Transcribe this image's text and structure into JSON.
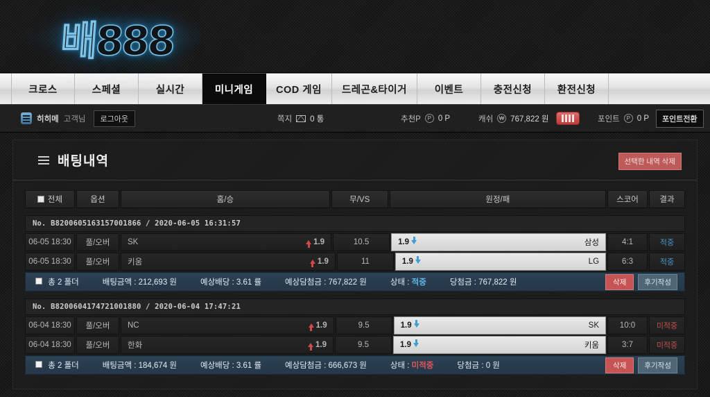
{
  "brand": {
    "logo_text": "배888"
  },
  "nav": {
    "items": [
      {
        "label": "크로스",
        "active": false
      },
      {
        "label": "스페셜",
        "active": false
      },
      {
        "label": "실시간",
        "active": false
      },
      {
        "label": "미니게임",
        "active": true
      },
      {
        "label": "COD 게임",
        "active": false
      },
      {
        "label": "드레곤&타이거",
        "active": false
      },
      {
        "label": "이벤트",
        "active": false
      },
      {
        "label": "충전신청",
        "active": false
      },
      {
        "label": "환전신청",
        "active": false
      }
    ]
  },
  "infobar": {
    "menu_icon": "hamburger-icon",
    "nickname": "히히메",
    "guest_label": "고객님",
    "logout_label": "로그아웃",
    "mail_label": "쪽지",
    "mail_icon": "envelope-icon",
    "mail_count": "0 통",
    "recommend_label": "추천P",
    "recommend_icon": "point-circle-icon",
    "recommend_value": "0 P",
    "cash_label": "캐쉬",
    "cash_icon": "won-circle-icon",
    "cash_value": "767,822 원",
    "cash_chip_icon": "cash-stack-icon",
    "point_label": "포인트",
    "point_icon": "point-circle-icon",
    "point_value": "0 P",
    "point_exchange_label": "포인트전환"
  },
  "panel": {
    "menu_icon": "hamburger-icon",
    "title": "배팅내역",
    "delete_selected_label": "선택한 내역 삭제",
    "accent_red": "#bf5a5a",
    "accent_blue": "#4a93c9"
  },
  "table": {
    "headers": {
      "all": "전체",
      "option": "옵션",
      "home": "홈/승",
      "draw": "무/VS",
      "away": "원정/패",
      "score": "스코어",
      "result": "결과"
    }
  },
  "tickets": [
    {
      "ticket_no": "No. B8200605163157001866 / 2020-06-05 16:31:57",
      "bets": [
        {
          "time": "06-05 18:30",
          "option": "풀/오버",
          "home_team": "SK",
          "home_odds": "1.9",
          "home_arrow": "up-arrow-icon",
          "home_selected": false,
          "draw": "10.5",
          "away_team": "삼성",
          "away_odds": "1.9",
          "away_arrow": "down-arrow-icon",
          "away_selected": true,
          "score": "4:1",
          "result": "적중",
          "result_hit": true
        },
        {
          "time": "06-05 18:30",
          "option": "풀/오버",
          "home_team": "키움",
          "home_odds": "1.9",
          "home_arrow": "up-arrow-icon",
          "home_selected": false,
          "draw": "11",
          "away_team": "LG",
          "away_odds": "1.9",
          "away_arrow": "down-arrow-icon",
          "away_selected": true,
          "score": "6:3",
          "result": "적중",
          "result_hit": true
        }
      ],
      "summary": {
        "folder": "총 2 폴더",
        "stake": "배팅금액 : 212,693 원",
        "odds": "예상배당 : 3.61 률",
        "expected": "예상담첨금 : 767,822 원",
        "status_label": "상태 : ",
        "status_value": "적중",
        "status_hit": true,
        "payout": "당첨금 : 767,822 원",
        "delete_label": "삭제",
        "review_label": "후기작성"
      }
    },
    {
      "ticket_no": "No. B8200604174721001880 / 2020-06-04 17:47:21",
      "bets": [
        {
          "time": "06-04 18:30",
          "option": "풀/오버",
          "home_team": "NC",
          "home_odds": "1.9",
          "home_arrow": "up-arrow-icon",
          "home_selected": false,
          "draw": "9.5",
          "away_team": "SK",
          "away_odds": "1.9",
          "away_arrow": "down-arrow-icon",
          "away_selected": true,
          "score": "10:0",
          "result": "미적중",
          "result_hit": false
        },
        {
          "time": "06-04 18:30",
          "option": "풀/오버",
          "home_team": "한화",
          "home_odds": "1.9",
          "home_arrow": "up-arrow-icon",
          "home_selected": false,
          "draw": "9.5",
          "away_team": "키움",
          "away_odds": "1.9",
          "away_arrow": "down-arrow-icon",
          "away_selected": true,
          "score": "3:7",
          "result": "미적중",
          "result_hit": false
        }
      ],
      "summary": {
        "folder": "총 2 폴더",
        "stake": "배팅금액 : 184,674 원",
        "odds": "예상배당 : 3.61 률",
        "expected": "예상담첨금 : 666,673 원",
        "status_label": "상태 : ",
        "status_value": "미적중",
        "status_hit": false,
        "payout": "당첨금 : 0 원",
        "delete_label": "삭제",
        "review_label": "후기작성"
      }
    }
  ]
}
